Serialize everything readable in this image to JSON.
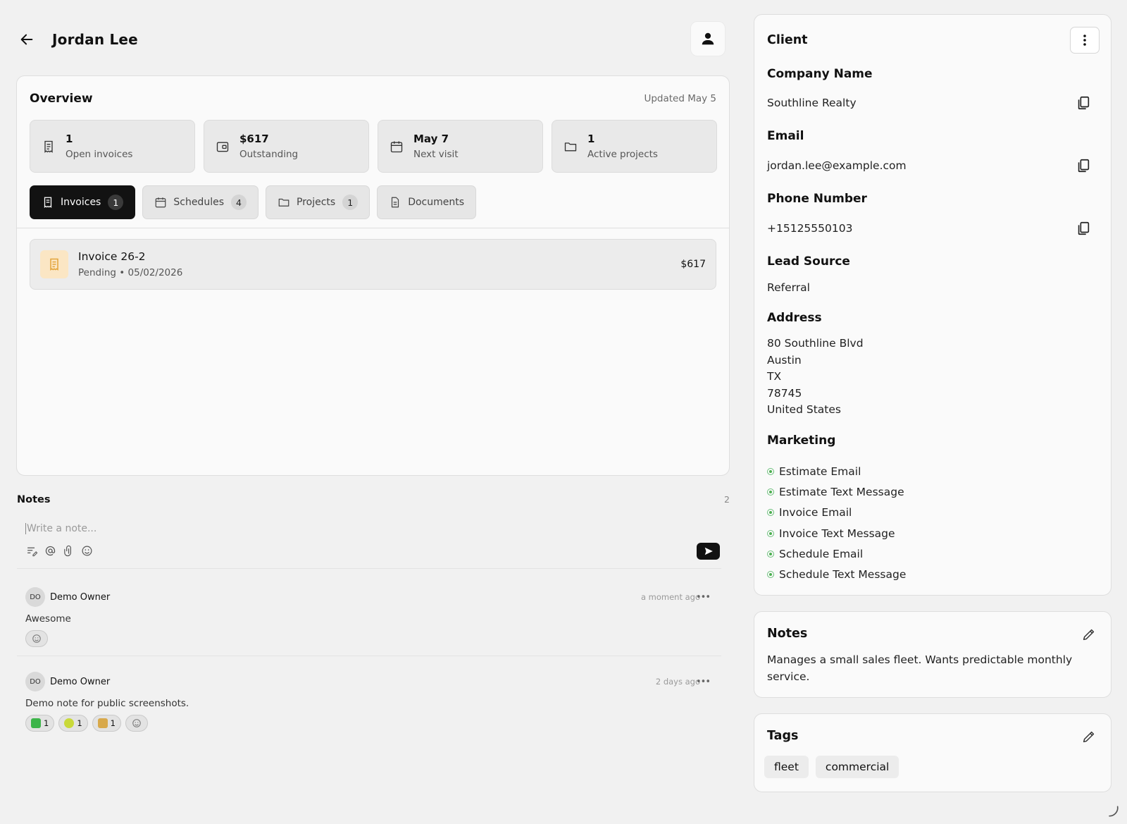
{
  "header": {
    "title": "Jordan Lee"
  },
  "overview": {
    "title": "Overview",
    "updated": "Updated May 5",
    "stats": [
      {
        "value": "1",
        "label": "Open invoices",
        "icon": "receipt-icon"
      },
      {
        "value": "$617",
        "label": "Outstanding",
        "icon": "wallet-icon"
      },
      {
        "value": "May 7",
        "label": "Next visit",
        "icon": "calendar-icon"
      },
      {
        "value": "1",
        "label": "Active projects",
        "icon": "folder-icon"
      }
    ],
    "tabs": [
      {
        "label": "Invoices",
        "count": "1",
        "active": true
      },
      {
        "label": "Schedules",
        "count": "4"
      },
      {
        "label": "Projects",
        "count": "1"
      },
      {
        "label": "Documents"
      }
    ],
    "invoice": {
      "title": "Invoice 26-2",
      "sub": "Pending • 05/02/2026",
      "amount": "$617"
    }
  },
  "notes": {
    "title": "Notes",
    "count": "2",
    "placeholder": "Write a note...",
    "comments": [
      {
        "initials": "DO",
        "author": "Demo Owner",
        "time": "a moment ago",
        "more": "•••",
        "body": "Awesome"
      },
      {
        "initials": "DO",
        "author": "Demo Owner",
        "time": "2 days ago",
        "more": "•••",
        "body": "Demo note for public screenshots.",
        "reactions": [
          {
            "emoji": "check-mark-emoji",
            "count": "1"
          },
          {
            "emoji": "tennis-ball-emoji",
            "count": "1"
          },
          {
            "emoji": "gift-emoji",
            "count": "1"
          }
        ]
      }
    ]
  },
  "client": {
    "title": "Client",
    "company_label": "Company Name",
    "company": "Southline Realty",
    "email_label": "Email",
    "email": "jordan.lee@example.com",
    "phone_label": "Phone Number",
    "phone": "+15125550103",
    "lead_label": "Lead Source",
    "lead": "Referral",
    "address_label": "Address",
    "address": [
      "80 Southline Blvd",
      "Austin",
      "TX",
      "78745",
      "United States"
    ],
    "marketing_label": "Marketing",
    "marketing": [
      "Estimate Email",
      "Estimate Text Message",
      "Invoice Email",
      "Invoice Text Message",
      "Schedule Email",
      "Schedule Text Message"
    ],
    "marketing_color": "#4caf50"
  },
  "client_notes": {
    "title": "Notes",
    "text": "Manages a small sales fleet. Wants predictable monthly service."
  },
  "tags": {
    "title": "Tags",
    "items": [
      "fleet",
      "commercial"
    ]
  },
  "colors": {
    "accent": "#121212",
    "invoice_icon_bg": "#fbe6c4",
    "invoice_icon": "#e3a43a"
  }
}
